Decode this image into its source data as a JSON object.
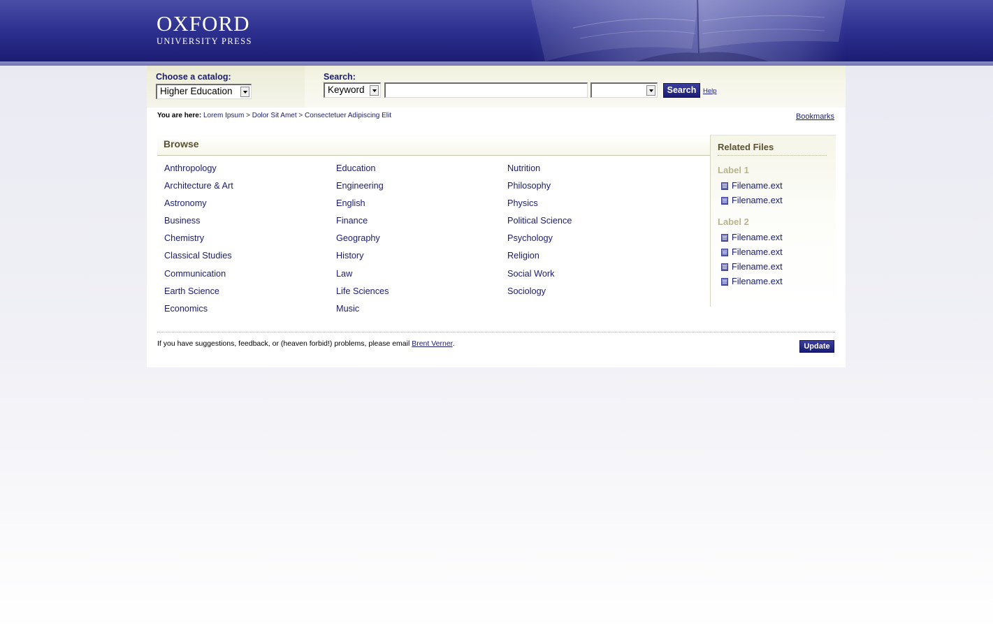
{
  "header": {
    "logo_main": "OXFORD",
    "logo_sub": "UNIVERSITY PRESS"
  },
  "searchbar": {
    "catalog_label": "Choose a catalog:",
    "catalog_value": "Higher Education",
    "search_label": "Search:",
    "search_type_value": "Keyword",
    "search_query": "",
    "filter_value": "",
    "search_button": "Search",
    "help_link": "Help"
  },
  "breadcrumb": {
    "label": "You are here:",
    "items": [
      "Lorem Ipsum",
      "Dolor Sit Amet",
      "Consectetuer Adipiscing Elit"
    ],
    "separator": ">"
  },
  "bookmarks": "Bookmarks",
  "browse": {
    "title": "Browse",
    "columns": [
      [
        "Anthropology",
        "Architecture & Art",
        "Astronomy",
        "Business",
        "Chemistry",
        "Classical Studies",
        "Communication",
        "Earth Science",
        "Economics"
      ],
      [
        "Education",
        "Engineering",
        "English",
        "Finance",
        "Geography",
        "History",
        "Law",
        "Life Sciences",
        "Music"
      ],
      [
        "Nutrition",
        "Philosophy",
        "Physics",
        "Political Science",
        "Psychology",
        "Religion",
        "Social Work",
        "Sociology"
      ]
    ]
  },
  "related_files": {
    "title": "Related Files",
    "groups": [
      {
        "label": "Label 1",
        "files": [
          "Filename.ext",
          "Filename.ext"
        ]
      },
      {
        "label": "Label 2",
        "files": [
          "Filename.ext",
          "Filename.ext",
          "Filename.ext",
          "Filename.ext"
        ]
      }
    ]
  },
  "footer": {
    "text": "If you have suggestions, feedback, or (heaven forbid!) problems, please email",
    "email_name": "Brent Verner",
    "text_end": ".",
    "update_button": "Update"
  },
  "colors": {
    "brand_navy": "#1e2078",
    "link": "#1a1c6e",
    "heading_olive": "#5a5132",
    "label_khaki": "#b8b48a"
  }
}
